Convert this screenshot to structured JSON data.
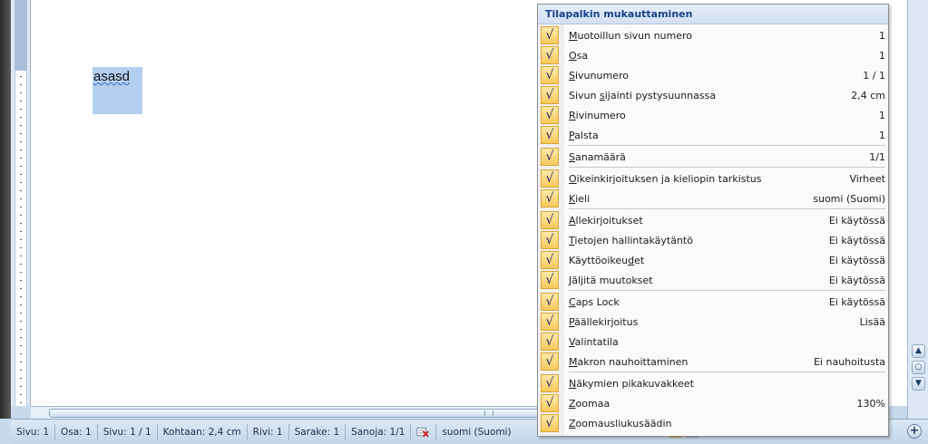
{
  "document": {
    "selected_text": "asasd"
  },
  "status_bar": {
    "items": [
      "Sivu: 1",
      "Osa: 1",
      "Sivu: 1 / 1",
      "Kohtaan: 2,4 cm",
      "Rivi: 1",
      "Sarake: 1",
      "Sanoja: 1/1",
      "suomi (Suomi)"
    ],
    "proofing_icon": "proofing-error-icon"
  },
  "menu": {
    "title": "Tilapalkin mukauttaminen",
    "check_glyph": "√",
    "groups": [
      [
        {
          "pre": "",
          "key": "M",
          "post": "uotoillun sivun numero",
          "value": "1"
        },
        {
          "pre": "",
          "key": "O",
          "post": "sa",
          "value": "1"
        },
        {
          "pre": "",
          "key": "S",
          "post": "ivunumero",
          "value": "1 / 1"
        },
        {
          "pre": "Sivun ",
          "key": "s",
          "post": "ijainti pystysuunnassa",
          "value": "2,4 cm"
        },
        {
          "pre": "",
          "key": "R",
          "post": "ivinumero",
          "value": "1"
        },
        {
          "pre": "",
          "key": "P",
          "post": "alsta",
          "value": "1"
        }
      ],
      [
        {
          "pre": "",
          "key": "S",
          "post": "anamäärä",
          "value": "1/1"
        }
      ],
      [
        {
          "pre": "",
          "key": "O",
          "post": "ikeinkirjoituksen ja kieliopin tarkistus",
          "value": "Virheet"
        },
        {
          "pre": "",
          "key": "K",
          "post": "ieli",
          "value": "suomi (Suomi)"
        }
      ],
      [
        {
          "pre": "",
          "key": "A",
          "post": "llekirjoitukset",
          "value": "Ei käytössä"
        },
        {
          "pre": "",
          "key": "T",
          "post": "ietojen hallintakäytäntö",
          "value": "Ei käytössä"
        },
        {
          "pre": "Käyttöoikeu",
          "key": "d",
          "post": "et",
          "value": "Ei käytössä"
        },
        {
          "pre": "",
          "key": "J",
          "post": "äljitä muutokset",
          "value": "Ei käytössä"
        }
      ],
      [
        {
          "pre": "",
          "key": "C",
          "post": "aps Lock",
          "value": "Ei käytössä"
        },
        {
          "pre": "",
          "key": "P",
          "post": "äällekirjoitus",
          "value": "Lisää"
        },
        {
          "pre": "",
          "key": "V",
          "post": "alintatila",
          "value": ""
        },
        {
          "pre": "",
          "key": "M",
          "post": "akron nauhoittaminen",
          "value": "Ei nauhoitusta"
        }
      ],
      [
        {
          "pre": "",
          "key": "N",
          "post": "äkymien pikakuvakkeet",
          "value": ""
        },
        {
          "pre": "",
          "key": "Z",
          "post": "oomaa",
          "value": "130%"
        },
        {
          "pre": "",
          "key": "Z",
          "post": "oomausliukusäädin",
          "value": ""
        }
      ]
    ]
  },
  "colors": {
    "check_bg": "#f8c95c",
    "selection": "#b3cff0",
    "menu_title": "#15428b"
  }
}
